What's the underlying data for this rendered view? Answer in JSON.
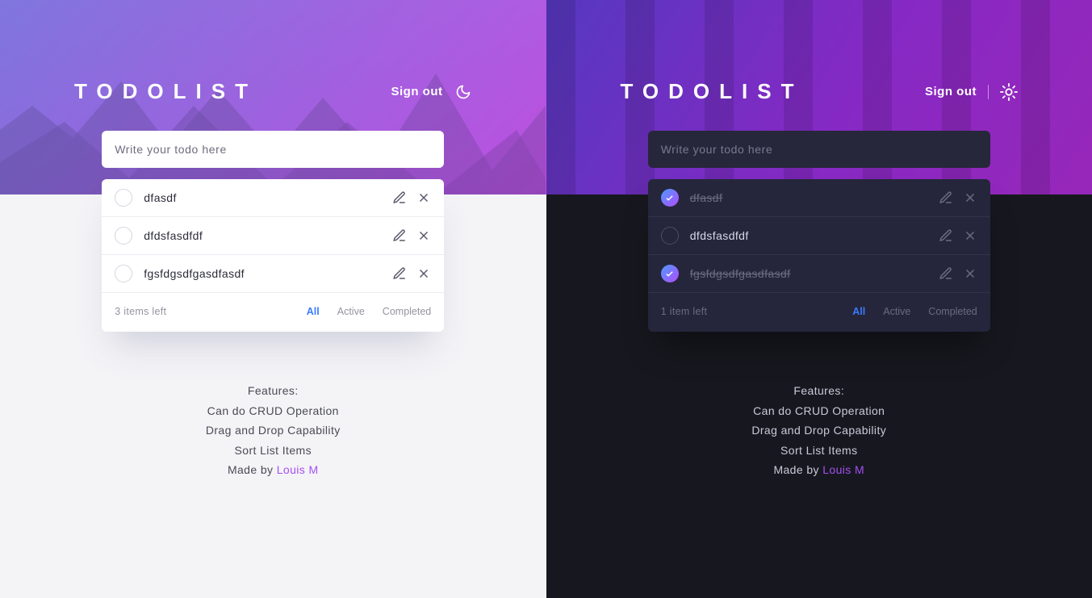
{
  "light": {
    "title": "TODOLIST",
    "signout": "Sign out",
    "theme_icon": "moon-icon",
    "input_placeholder": "Write your todo here",
    "items": [
      {
        "label": "dfasdf",
        "done": false
      },
      {
        "label": "dfdsfasdfdf",
        "done": false
      },
      {
        "label": "fgsfdgsdfgasdfasdf",
        "done": false
      }
    ],
    "items_left": "3 items left",
    "filters": {
      "all": "All",
      "active": "Active",
      "completed": "Completed",
      "selected": "all"
    }
  },
  "dark": {
    "title": "TODOLIST",
    "signout": "Sign out",
    "theme_icon": "sun-icon",
    "input_placeholder": "Write your todo here",
    "items": [
      {
        "label": "dfasdf",
        "done": true
      },
      {
        "label": "dfdsfasdfdf",
        "done": false
      },
      {
        "label": "fgsfdgsdfgasdfasdf",
        "done": true
      }
    ],
    "items_left": "1 item left",
    "filters": {
      "all": "All",
      "active": "Active",
      "completed": "Completed",
      "selected": "all"
    }
  },
  "features": {
    "heading": "Features:",
    "lines": [
      "Can do CRUD Operation",
      "Drag and Drop Capability",
      "Sort List Items"
    ],
    "made_by_prefix": "Made by ",
    "made_by_name": "Louis M"
  }
}
